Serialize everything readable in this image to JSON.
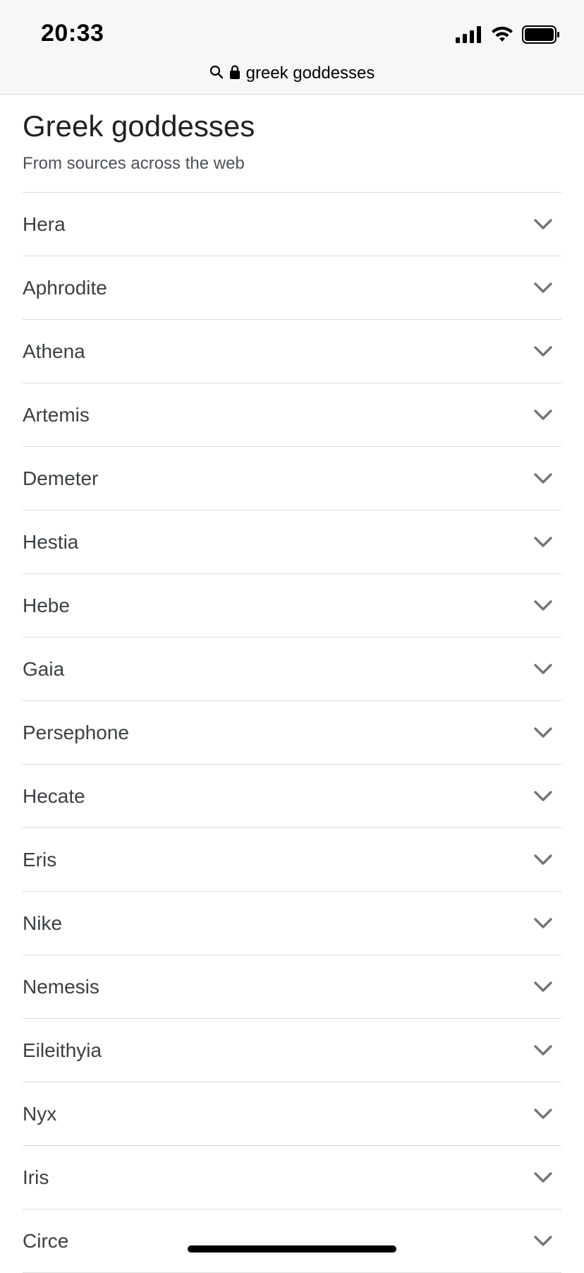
{
  "status_bar": {
    "time": "20:33"
  },
  "address_bar": {
    "url": "greek goddesses",
    "icons": [
      "search-icon",
      "lock-icon"
    ]
  },
  "header": {
    "title": "Greek goddesses",
    "subtitle": "From sources across the web"
  },
  "goddesses": [
    {
      "label": "Hera"
    },
    {
      "label": "Aphrodite"
    },
    {
      "label": "Athena"
    },
    {
      "label": "Artemis"
    },
    {
      "label": "Demeter"
    },
    {
      "label": "Hestia"
    },
    {
      "label": "Hebe"
    },
    {
      "label": "Gaia"
    },
    {
      "label": "Persephone"
    },
    {
      "label": "Hecate"
    },
    {
      "label": "Eris"
    },
    {
      "label": "Nike"
    },
    {
      "label": "Nemesis"
    },
    {
      "label": "Eileithyia"
    },
    {
      "label": "Nyx"
    },
    {
      "label": "Iris"
    },
    {
      "label": "Circe"
    }
  ],
  "colors": {
    "divider": "#dadce0",
    "chevron": "#70757a",
    "text": "#3c4043"
  }
}
